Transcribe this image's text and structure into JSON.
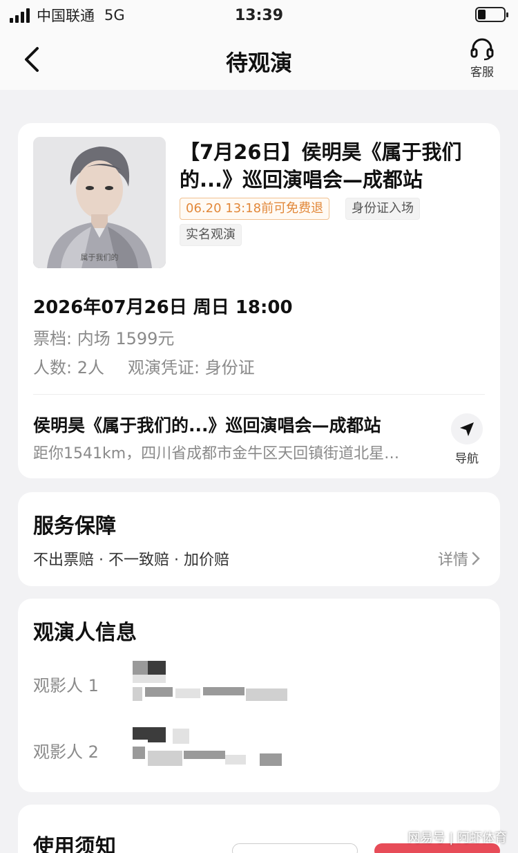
{
  "status_bar": {
    "carrier": "中国联通",
    "network": "5G",
    "time": "13:39",
    "battery_level": 0.3
  },
  "nav": {
    "title": "待观演",
    "service_label": "客服",
    "back_icon": "chevron-left-icon",
    "service_icon": "headset-icon"
  },
  "order": {
    "poster_icon": "artist-poster-image",
    "poster_caption": "属于我们的",
    "title": "【7月26日】侯明昊《属于我们的...》巡回演唱会—成都站",
    "tags": {
      "refund": "06.20 13:18前可免费退",
      "id_entry": "身份证入场",
      "real_name": "实名观演"
    },
    "datetime": "2026年07月26日 周日 18:00",
    "ticket_tier": "票档: 内场 1599元",
    "people_count": "人数: 2人",
    "credential": "观演凭证: 身份证",
    "venue_name": "侯明昊《属于我们的...》巡回演唱会—成都站",
    "venue_address": "距你1541km，四川省成都市金牛区天回镇街道北星…",
    "nav_label": "导航",
    "nav_icon": "navigation-arrow-icon"
  },
  "service": {
    "title": "服务保障",
    "guarantees": "不出票赔 · 不一致赔 · 加价赔",
    "details_label": "详情",
    "details_icon": "chevron-right-icon"
  },
  "viewers": {
    "title": "观演人信息",
    "items": [
      {
        "label": "观影人 1"
      },
      {
        "label": "观影人 2"
      }
    ]
  },
  "notice": {
    "title": "使用须知"
  },
  "watermark": "网易号 | 阿虾体育",
  "colors": {
    "accent_orange": "#e2883a",
    "background": "#f2f2f4",
    "card": "#ffffff",
    "secondary_text": "#8a8a8a"
  }
}
